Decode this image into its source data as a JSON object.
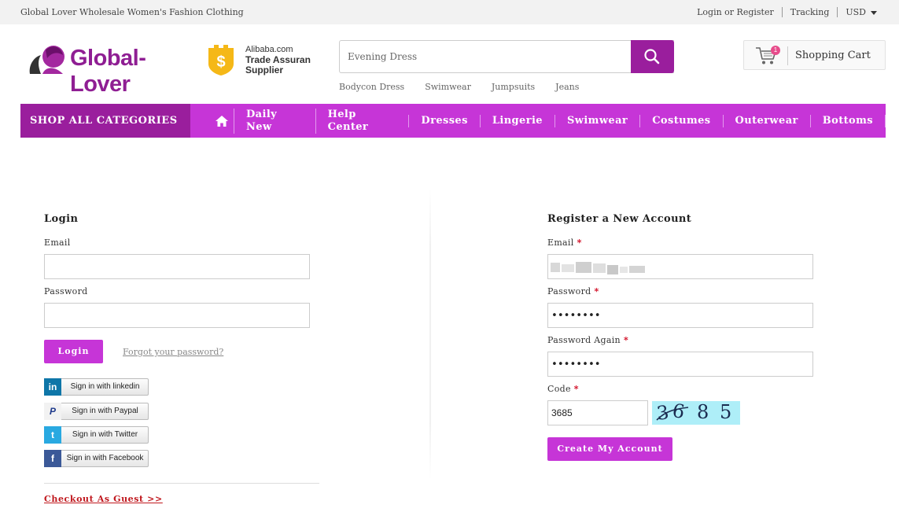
{
  "topbar": {
    "tagline": "Global Lover Wholesale Women's Fashion Clothing",
    "login_register": "Login or Register",
    "tracking": "Tracking",
    "currency": "USD"
  },
  "header": {
    "logo_text": "Global-Lover",
    "assurance": {
      "line1": "Alibaba.com",
      "line2": "Trade Assuran",
      "line3": "Supplier"
    },
    "search": {
      "value": "Evening Dress"
    },
    "hot_searches": [
      "Bodycon Dress",
      "Swimwear",
      "Jumpsuits",
      "Jeans"
    ],
    "cart": {
      "count": "1",
      "label": "Shopping Cart"
    }
  },
  "nav": {
    "all_categories": "SHOP ALL CATEGORIES",
    "items": [
      "Daily New",
      "Help Center",
      "Dresses",
      "Lingerie",
      "Swimwear",
      "Costumes",
      "Outerwear",
      "Bottoms"
    ]
  },
  "login": {
    "title": "Login",
    "email_label": "Email",
    "password_label": "Password",
    "button": "Login",
    "forgot": "Forgot your password?",
    "social": [
      {
        "icon": "linkedin-icon",
        "label": "Sign in with linkedin",
        "color": "#0e76a8"
      },
      {
        "icon": "paypal-icon",
        "label": "Sign in with Paypal",
        "color": "#1f3b8c"
      },
      {
        "icon": "twitter-icon",
        "label": "Sign in with Twitter",
        "color": "#29a9e1"
      },
      {
        "icon": "facebook-icon",
        "label": "Sign in with Facebook",
        "color": "#3b5998"
      }
    ],
    "guest": "Checkout As Guest >>"
  },
  "register": {
    "title": "Register a New Account",
    "email_label": "Email",
    "password_label": "Password",
    "password_value": "••••••••",
    "password_again_label": "Password Again",
    "password_again_value": "••••••••",
    "code_label": "Code",
    "code_value": "3685",
    "captcha_digits": [
      "3",
      "6",
      "8",
      "5"
    ],
    "button": "Create My Account"
  },
  "colors": {
    "brand_dark": "#9a1e9d",
    "brand": "#c635d7",
    "required": "#d0021b",
    "guest_link": "#c0181e"
  }
}
